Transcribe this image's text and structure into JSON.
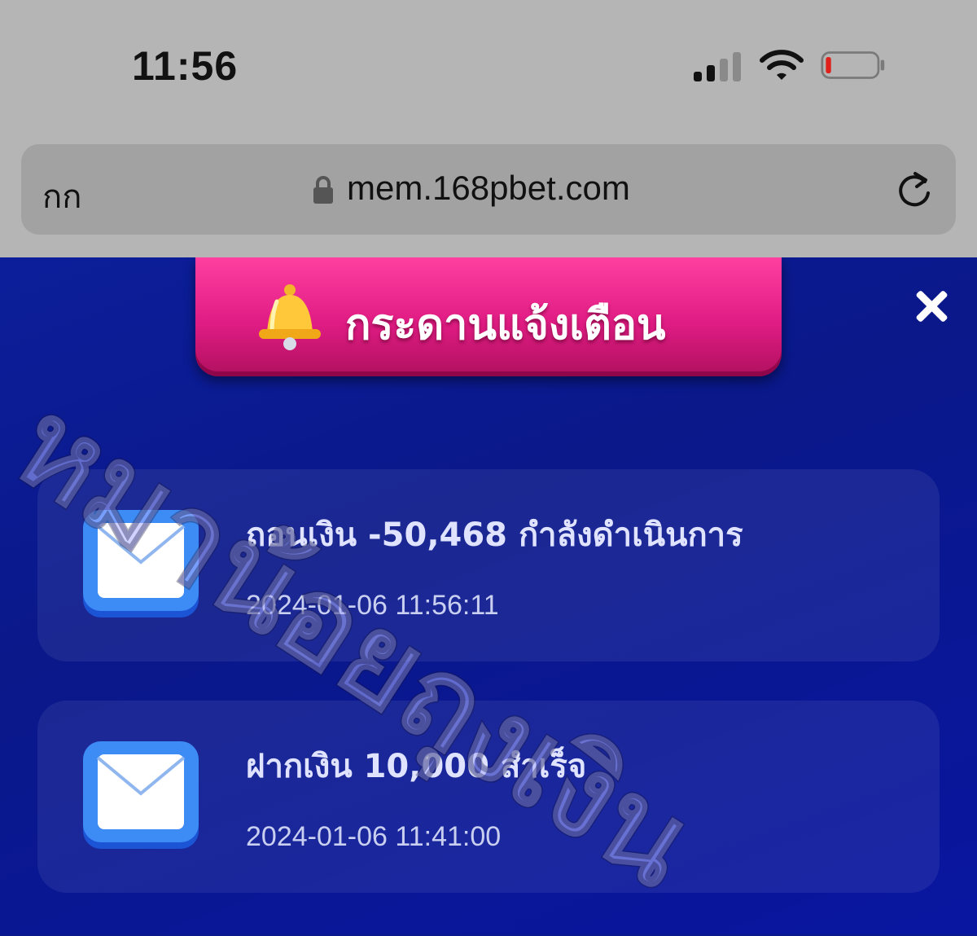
{
  "status_bar": {
    "time": "11:56"
  },
  "browser": {
    "text_size_label": "กก",
    "url": "mem.168pbet.com"
  },
  "header": {
    "title": "กระดานแจ้งเตือน"
  },
  "notifications": [
    {
      "message": "ถอนเงิน -50,468 กำลังดำเนินการ",
      "timestamp": "2024-01-06 11:56:11",
      "icon": "envelope-icon"
    },
    {
      "message": "ฝากเงิน 10,000 สำเร็จ",
      "timestamp": "2024-01-06 11:41:00",
      "icon": "envelope-icon"
    }
  ],
  "watermark": "หมาน้อยถุงเงิน",
  "colors": {
    "banner": "#e01c84",
    "background": "#0a1a8c",
    "envelope": "#2f7cf0"
  }
}
